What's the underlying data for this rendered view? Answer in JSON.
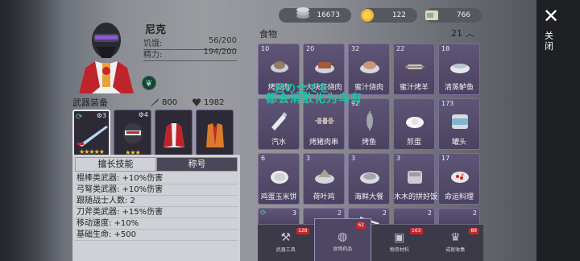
{
  "character": {
    "name": "尼克",
    "hunger_label": "饥饿:",
    "hunger_value": "56/200",
    "energy_label": "精力:",
    "energy_value": "194/200"
  },
  "weapons": {
    "title": "武器装备",
    "attack": "800",
    "health": "1982",
    "slots": [
      {
        "num": "3",
        "stars": "★★★★★"
      },
      {
        "num": "4",
        "stars": "★★★"
      },
      {
        "num": "",
        "stars": ""
      },
      {
        "num": "",
        "stars": ""
      }
    ]
  },
  "skills": {
    "tab_specialty": "擅长技能",
    "tab_title": "称号",
    "lines": [
      "棍棒类武器: +10%伤害",
      "弓弩类武器: +10%伤害",
      "跟随战士人数: 2",
      "刀斧类武器: +15%伤害",
      "移动速度: +10%",
      "基础生命: +500"
    ]
  },
  "resources": {
    "silver": "16673",
    "gold": "122",
    "cards": "766"
  },
  "food": {
    "title": "食物",
    "count": "21",
    "items": [
      {
        "qty": "10",
        "label": "烤兔肉"
      },
      {
        "qty": "20",
        "label": "大块红烧肉"
      },
      {
        "qty": "32",
        "label": "蜜汁烧肉"
      },
      {
        "qty": "22",
        "label": "蜜汁烤羊"
      },
      {
        "qty": "18",
        "label": "清蒸鲈鱼"
      },
      {
        "qty": "",
        "label": "汽水"
      },
      {
        "qty": "",
        "label": "烤猪肉串"
      },
      {
        "qty": "92",
        "label": "烤鱼"
      },
      {
        "qty": "",
        "label": "煎蛋"
      },
      {
        "qty": "173",
        "label": "罐头"
      },
      {
        "qty": "6",
        "label": "鸡蛋玉米饼"
      },
      {
        "qty": "3",
        "label": "荷叶鸡"
      },
      {
        "qty": "3",
        "label": "海鲜大餐"
      },
      {
        "qty": "3",
        "label": "木木的拼好饭"
      },
      {
        "qty": "17",
        "label": "命运料理"
      },
      {
        "qty": "3",
        "label": ""
      },
      {
        "qty": "2",
        "label": ""
      },
      {
        "qty": "2",
        "label": ""
      },
      {
        "qty": "2",
        "label": ""
      },
      {
        "qty": "2",
        "label": ""
      }
    ]
  },
  "overlay": {
    "line1": "君の全てを",
    "line2": "都会消散化为乌有"
  },
  "bottom_tabs": [
    {
      "label": "武器工具",
      "badge": "128"
    },
    {
      "label": "食物药品",
      "badge": "62"
    },
    {
      "label": "物资材料",
      "badge": "163"
    },
    {
      "label": "成就收集",
      "badge": "89"
    }
  ],
  "close_label": "关闭"
}
